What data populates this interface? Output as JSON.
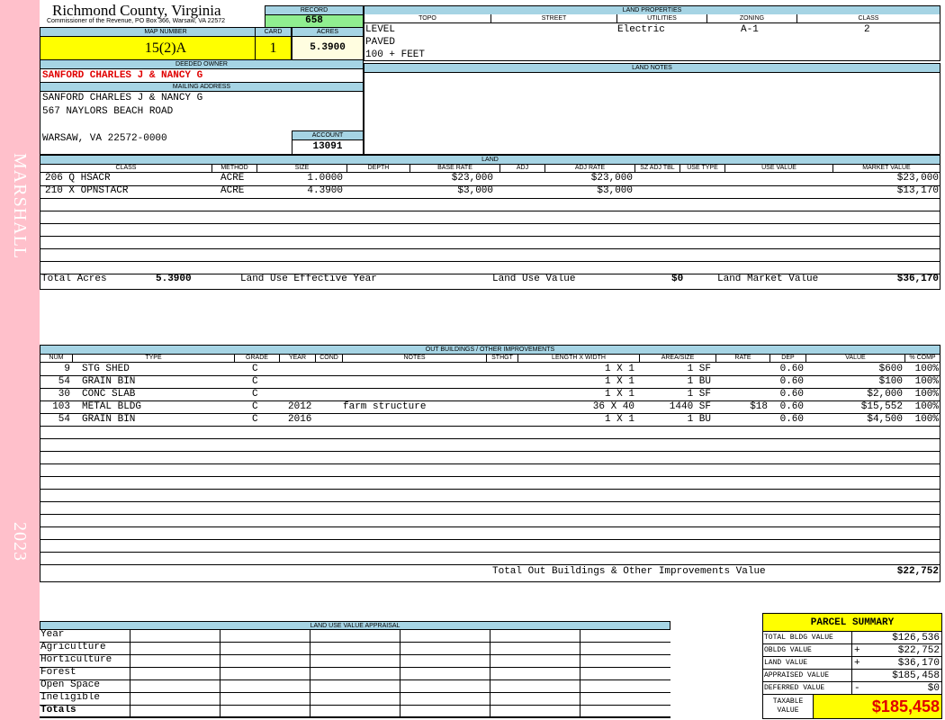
{
  "sidebar": {
    "district": "MARSHALL",
    "year": "2023"
  },
  "header": {
    "county": "Richmond County, Virginia",
    "commissioner": "Commissioner of the Revenue, PO Box 366, Warsaw, VA 22572",
    "record_label": "RECORD",
    "record": "658",
    "map_number_label": "MAP NUMBER",
    "map_number": "15(2)A",
    "card_label": "CARD",
    "card": "1",
    "acres_label": "ACRES",
    "acres": "5.3900"
  },
  "owner": {
    "deeded_owner_label": "DEEDED OWNER",
    "deeded_owner": "SANFORD CHARLES J & NANCY G",
    "mailing_label": "MAILING ADDRESS",
    "mailing_lines": [
      "SANFORD CHARLES J & NANCY G",
      "567 NAYLORS BEACH ROAD",
      "",
      "WARSAW, VA 22572-0000"
    ],
    "account_label": "ACCOUNT",
    "account": "13091"
  },
  "land_properties": {
    "title": "LAND PROPERTIES",
    "columns": [
      "TOPO",
      "STREET",
      "UTILITIES",
      "ZONING",
      "CLASS"
    ],
    "topo": [
      "LEVEL",
      "PAVED",
      "100 + FEET"
    ],
    "utilities": "Electric",
    "zoning": "A-1",
    "class": "2"
  },
  "land_notes": {
    "title": "LAND NOTES"
  },
  "land": {
    "title": "LAND",
    "columns": [
      "CLASS",
      "METHOD",
      "SIZE",
      "DEPTH",
      "BASE RATE",
      "ADJ",
      "ADJ RATE",
      "SZ ADJ TBL",
      "USE TYPE",
      "USE VALUE",
      "MARKET VALUE"
    ],
    "rows": [
      {
        "class": "206 Q HSACR",
        "method": "ACRE",
        "size": "1.0000",
        "base_rate": "$23,000",
        "adj_rate": "$23,000",
        "market_value": "$23,000"
      },
      {
        "class": "210 X OPNSTACR",
        "method": "ACRE",
        "size": "4.3900",
        "base_rate": "$3,000",
        "adj_rate": "$3,000",
        "market_value": "$13,170"
      }
    ],
    "total_acres_label": "Total Acres",
    "total_acres": "5.3900",
    "effective_year_label": "Land Use Effective Year",
    "use_value_label": "Land Use Value",
    "use_value": "$0",
    "market_value_label": "Land Market Value",
    "market_value": "$36,170"
  },
  "outbuildings": {
    "title": "OUT BUILDINGS / OTHER IMPROVEMENTS",
    "columns": [
      "NUM",
      "TYPE",
      "GRADE",
      "YEAR",
      "COND",
      "NOTES",
      "STHGT",
      "LENGTH X WIDTH",
      "AREA/SIZE",
      "RATE",
      "DEP",
      "VALUE",
      "% COMP"
    ],
    "rows": [
      {
        "num": "9",
        "type": "STG SHED",
        "grade": "C",
        "year": "",
        "notes": "",
        "lw": "1 X 1",
        "area": "1 SF",
        "rate": "",
        "dep": "0.60",
        "value": "$600",
        "comp": "100%"
      },
      {
        "num": "54",
        "type": "GRAIN BIN",
        "grade": "C",
        "year": "",
        "notes": "",
        "lw": "1 X 1",
        "area": "1 BU",
        "rate": "",
        "dep": "0.60",
        "value": "$100",
        "comp": "100%"
      },
      {
        "num": "30",
        "type": "CONC SLAB",
        "grade": "C",
        "year": "",
        "notes": "",
        "lw": "1 X 1",
        "area": "1 SF",
        "rate": "",
        "dep": "0.60",
        "value": "$2,000",
        "comp": "100%"
      },
      {
        "num": "103",
        "type": "METAL BLDG",
        "grade": "C",
        "year": "2012",
        "notes": "farm structure",
        "lw": "36 X 40",
        "area": "1440 SF",
        "rate": "$18",
        "dep": "0.60",
        "value": "$15,552",
        "comp": "100%"
      },
      {
        "num": "54",
        "type": "GRAIN BIN",
        "grade": "C",
        "year": "2016",
        "notes": "",
        "lw": "1 X 1",
        "area": "1 BU",
        "rate": "",
        "dep": "0.60",
        "value": "$4,500",
        "comp": "100%"
      }
    ],
    "total_label": "Total Out Buildings & Other Improvements Value",
    "total": "$22,752"
  },
  "land_use": {
    "title": "LAND USE VALUE APPRAISAL",
    "rows": [
      "Year",
      "Agriculture",
      "Horticulture",
      "Forest",
      "Open Space",
      "Ineligible",
      "Totals"
    ]
  },
  "summary": {
    "title": "PARCEL SUMMARY",
    "rows": [
      {
        "label": "TOTAL BLDG VALUE",
        "op": "",
        "value": "$126,536"
      },
      {
        "label": "OBLDG VALUE",
        "op": "+",
        "value": "$22,752"
      },
      {
        "label": "LAND VALUE",
        "op": "+",
        "value": "$36,170"
      },
      {
        "label": "APPRAISED VALUE",
        "op": "",
        "value": "$185,458"
      },
      {
        "label": "DEFERRED VALUE",
        "op": "-",
        "value": "$0"
      }
    ],
    "taxable_label_1": "TAXABLE",
    "taxable_label_2": "VALUE",
    "taxable": "$185,458"
  }
}
